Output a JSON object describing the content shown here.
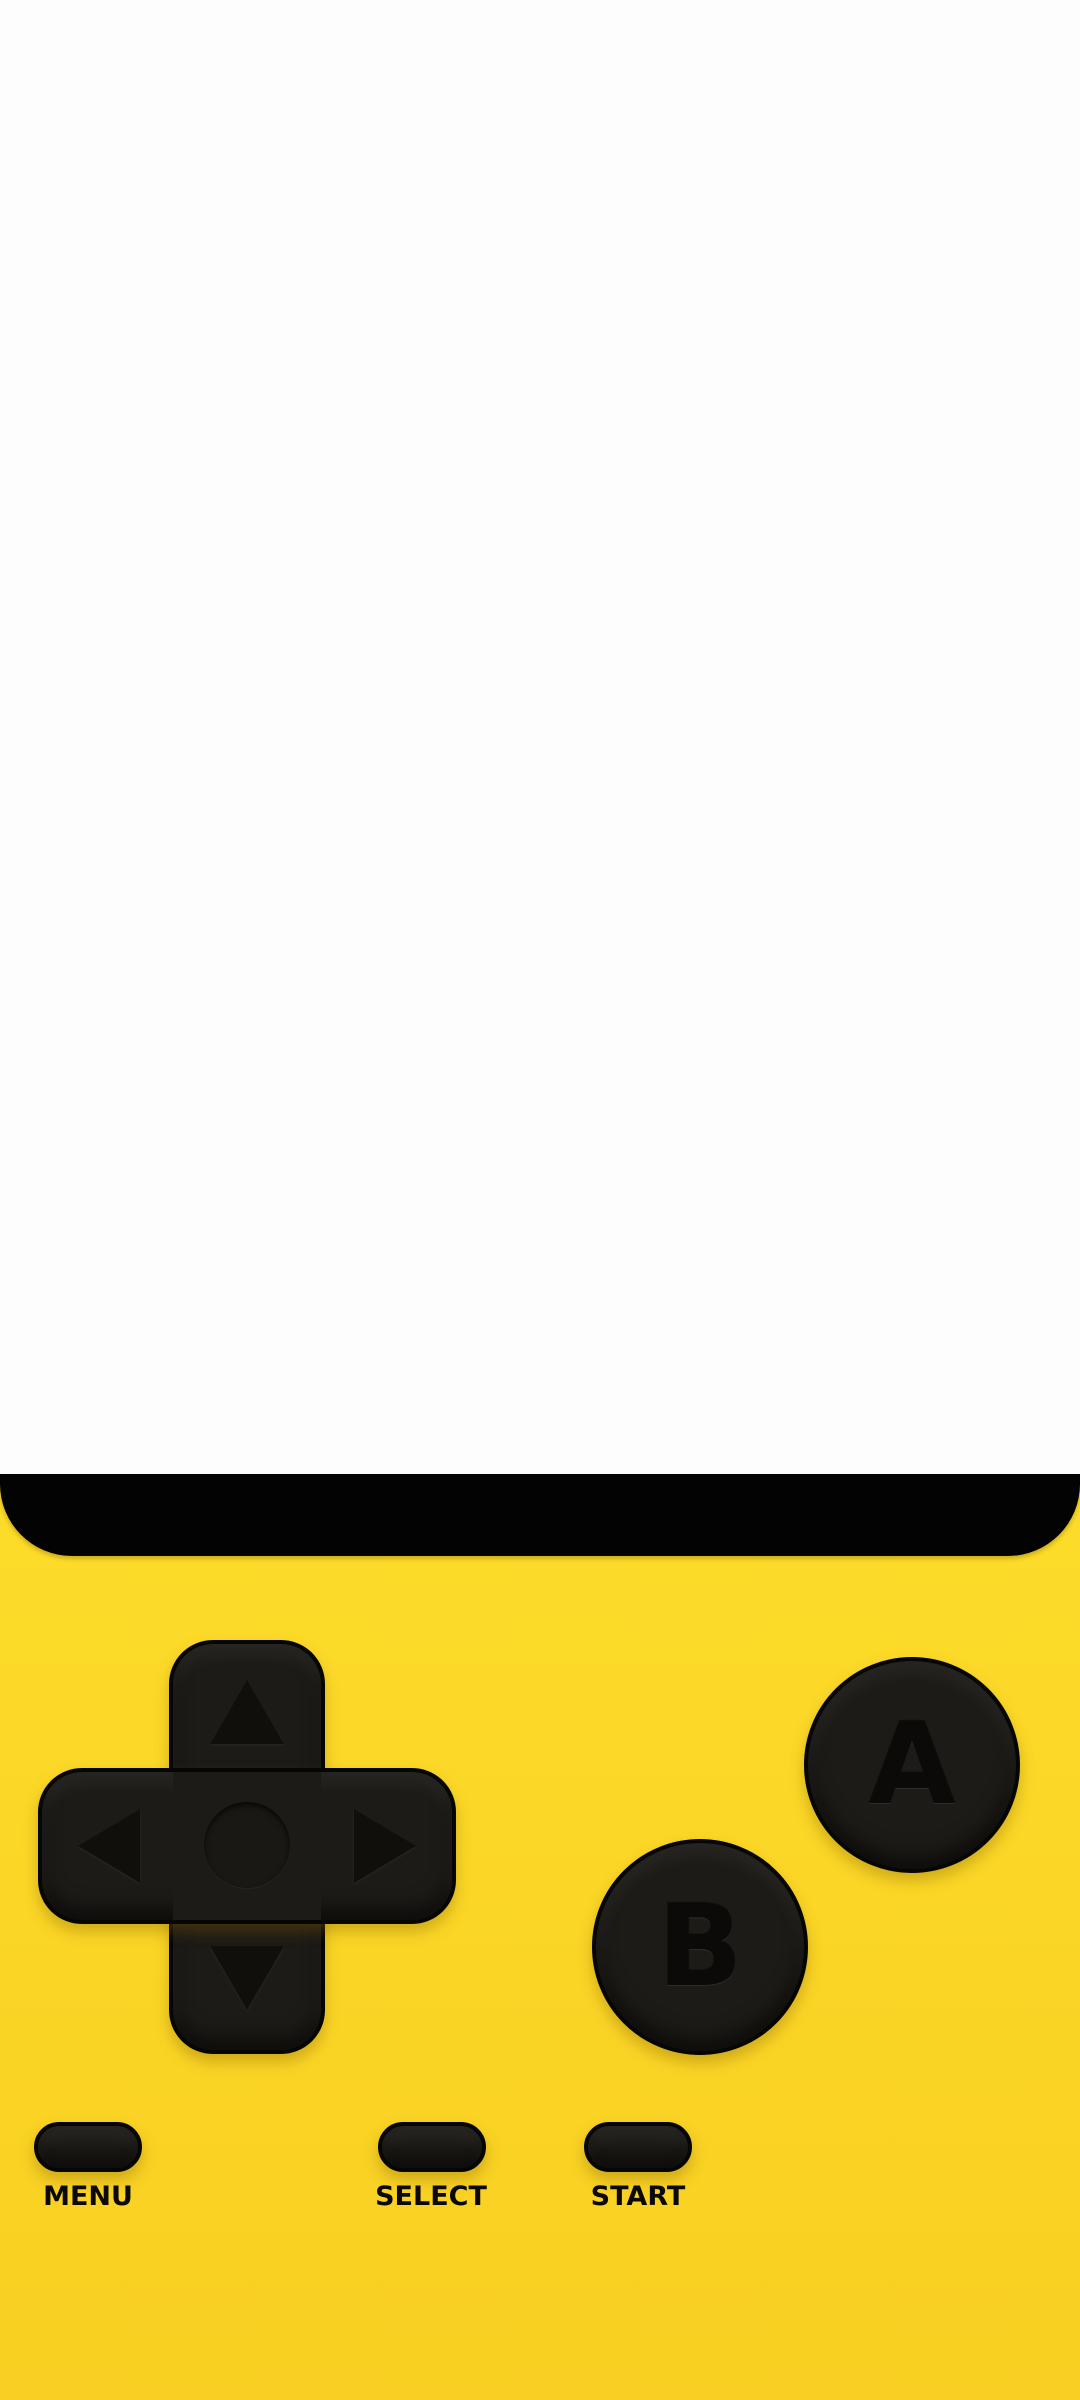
{
  "controls": {
    "a_label": "A",
    "b_label": "B",
    "menu_label": "MENU",
    "select_label": "SELECT",
    "start_label": "START"
  },
  "colors": {
    "body": "#fdd928",
    "buttons": "#1d1b17",
    "bezel": "#030303",
    "screen": "#fdfdfd"
  }
}
